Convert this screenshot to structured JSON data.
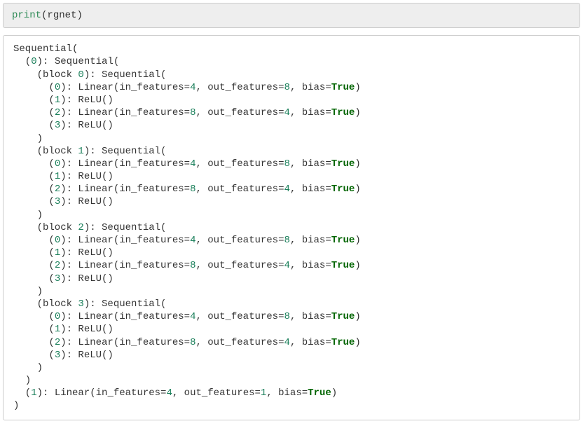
{
  "input": {
    "fn": "print",
    "open": "(",
    "arg": "rgnet",
    "close": ")"
  },
  "out": {
    "seq_open": "Sequential(",
    "top0_open_a": "  (",
    "top0_open_num": "0",
    "top0_open_b": "): Sequential(",
    "blocks": [
      {
        "open_a": "    (block ",
        "open_num": "0",
        "open_b": "): Sequential(",
        "l0a": "      (",
        "l0n": "0",
        "l0b": "): Linear(in_features=",
        "l0f1": "4",
        "l0c": ", out_features=",
        "l0f2": "8",
        "l0d": ", bias=",
        "l0t": "True",
        "l0e": ")",
        "l1a": "      (",
        "l1n": "1",
        "l1b": "): ReLU()",
        "l2a": "      (",
        "l2n": "2",
        "l2b": "): Linear(in_features=",
        "l2f1": "8",
        "l2c": ", out_features=",
        "l2f2": "4",
        "l2d": ", bias=",
        "l2t": "True",
        "l2e": ")",
        "l3a": "      (",
        "l3n": "3",
        "l3b": "): ReLU()",
        "close": "    )"
      },
      {
        "open_a": "    (block ",
        "open_num": "1",
        "open_b": "): Sequential(",
        "l0a": "      (",
        "l0n": "0",
        "l0b": "): Linear(in_features=",
        "l0f1": "4",
        "l0c": ", out_features=",
        "l0f2": "8",
        "l0d": ", bias=",
        "l0t": "True",
        "l0e": ")",
        "l1a": "      (",
        "l1n": "1",
        "l1b": "): ReLU()",
        "l2a": "      (",
        "l2n": "2",
        "l2b": "): Linear(in_features=",
        "l2f1": "8",
        "l2c": ", out_features=",
        "l2f2": "4",
        "l2d": ", bias=",
        "l2t": "True",
        "l2e": ")",
        "l3a": "      (",
        "l3n": "3",
        "l3b": "): ReLU()",
        "close": "    )"
      },
      {
        "open_a": "    (block ",
        "open_num": "2",
        "open_b": "): Sequential(",
        "l0a": "      (",
        "l0n": "0",
        "l0b": "): Linear(in_features=",
        "l0f1": "4",
        "l0c": ", out_features=",
        "l0f2": "8",
        "l0d": ", bias=",
        "l0t": "True",
        "l0e": ")",
        "l1a": "      (",
        "l1n": "1",
        "l1b": "): ReLU()",
        "l2a": "      (",
        "l2n": "2",
        "l2b": "): Linear(in_features=",
        "l2f1": "8",
        "l2c": ", out_features=",
        "l2f2": "4",
        "l2d": ", bias=",
        "l2t": "True",
        "l2e": ")",
        "l3a": "      (",
        "l3n": "3",
        "l3b": "): ReLU()",
        "close": "    )"
      },
      {
        "open_a": "    (block ",
        "open_num": "3",
        "open_b": "): Sequential(",
        "l0a": "      (",
        "l0n": "0",
        "l0b": "): Linear(in_features=",
        "l0f1": "4",
        "l0c": ", out_features=",
        "l0f2": "8",
        "l0d": ", bias=",
        "l0t": "True",
        "l0e": ")",
        "l1a": "      (",
        "l1n": "1",
        "l1b": "): ReLU()",
        "l2a": "      (",
        "l2n": "2",
        "l2b": "): Linear(in_features=",
        "l2f1": "8",
        "l2c": ", out_features=",
        "l2f2": "4",
        "l2d": ", bias=",
        "l2t": "True",
        "l2e": ")",
        "l3a": "      (",
        "l3n": "3",
        "l3b": "): ReLU()",
        "close": "    )"
      }
    ],
    "top0_close": "  )",
    "top1_a": "  (",
    "top1_n": "1",
    "top1_b": "): Linear(in_features=",
    "top1_f1": "4",
    "top1_c": ", out_features=",
    "top1_f2": "1",
    "top1_d": ", bias=",
    "top1_t": "True",
    "top1_e": ")",
    "seq_close": ")"
  }
}
